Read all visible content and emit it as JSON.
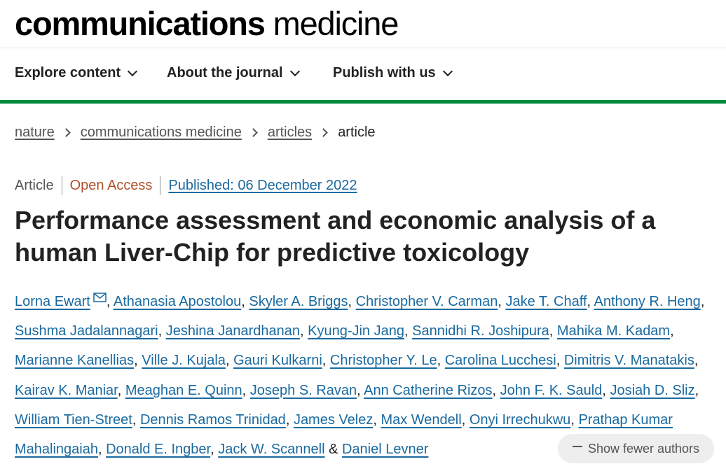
{
  "journal": {
    "brand_bold": "communications",
    "brand_light": "medicine"
  },
  "nav": {
    "items": [
      {
        "label": "Explore content"
      },
      {
        "label": "About the journal"
      },
      {
        "label": "Publish with us"
      }
    ]
  },
  "breadcrumb": {
    "items": [
      "nature",
      "communications medicine",
      "articles"
    ],
    "current": "article"
  },
  "article": {
    "type": "Article",
    "access": "Open Access",
    "published": "Published: 06 December 2022",
    "title": "Performance assessment and economic analysis of a human Liver-Chip for predictive toxicology"
  },
  "authors": [
    "Lorna Ewart",
    "Athanasia Apostolou",
    "Skyler A. Briggs",
    "Christopher V. Carman",
    "Jake T. Chaff",
    "Anthony R. Heng",
    "Sushma Jadalannagari",
    "Jeshina Janardhanan",
    "Kyung-Jin Jang",
    "Sannidhi R. Joshipura",
    "Mahika M. Kadam",
    "Marianne Kanellias",
    "Ville J. Kujala",
    "Gauri Kulkarni",
    "Christopher Y. Le",
    "Carolina Lucchesi",
    "Dimitris V. Manatakis",
    "Kairav K. Maniar",
    "Meaghan E. Quinn",
    "Joseph S. Ravan",
    "Ann Catherine Rizos",
    "John F. K. Sauld",
    "Josiah D. Sliz",
    "William Tien-Street",
    "Dennis Ramos Trinidad",
    "James Velez",
    "Max Wendell",
    "Onyi Irrechukwu",
    "Prathap Kumar Mahalingaiah",
    "Donald E. Ingber",
    "Jack W. Scannell",
    "Daniel Levner"
  ],
  "authors_separator": ", ",
  "authors_last_joiner": " & ",
  "show_fewer_label": "Show fewer authors",
  "icons": {
    "corresponding_author": "mail-icon",
    "nav_dropdown": "chevron-down-icon",
    "breadcrumb_sep": "chevron-right-icon",
    "collapse": "minus-icon"
  },
  "colors": {
    "link": "#1a6aa0",
    "open_access": "#b0502b",
    "accent_rule": "#008a3a"
  }
}
